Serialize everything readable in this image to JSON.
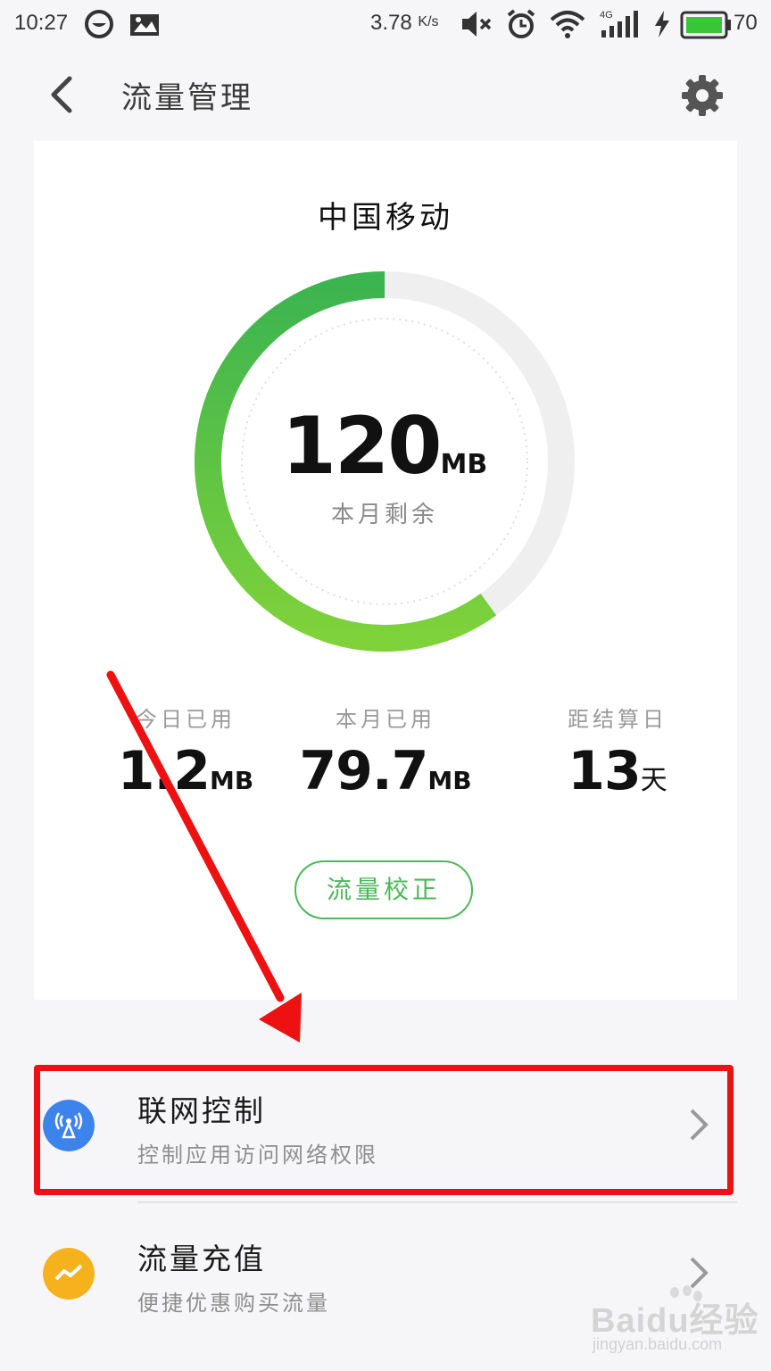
{
  "status_bar": {
    "time": "10:27",
    "speed_value": "3.78",
    "speed_unit": "K/s",
    "network_type": "4G",
    "battery_level": "70",
    "icons": [
      "chat-bubble-icon",
      "image-notification-icon",
      "mute-icon",
      "alarm-icon",
      "wifi-icon",
      "signal-icon",
      "charging-icon",
      "battery-icon"
    ]
  },
  "header": {
    "title": "流量管理",
    "back_icon": "back-arrow-icon",
    "settings_icon": "gear-icon"
  },
  "card": {
    "carrier": "中国移动",
    "remaining": {
      "value": "120",
      "unit": "MB",
      "label": "本月剩余",
      "ring_fill_fraction": 0.6
    },
    "stats": [
      {
        "label": "今日已用",
        "value": "1.2",
        "unit": "MB"
      },
      {
        "label": "本月已用",
        "value": "79.7",
        "unit": "MB"
      },
      {
        "label": "距结算日",
        "value": "13",
        "unit": "天"
      }
    ],
    "calibrate_button": "流量校正"
  },
  "list": [
    {
      "title": "联网控制",
      "subtitle": "控制应用访问网络权限",
      "icon": "antenna-icon",
      "icon_color": "#3d83ec"
    },
    {
      "title": "流量充值",
      "subtitle": "便捷优惠购买流量",
      "icon": "trend-icon",
      "icon_color": "#f6b21c"
    }
  ],
  "colors": {
    "accent_green": "#4cb85a",
    "ring_green_start": "#3cb450",
    "ring_green_end": "#7fd23a",
    "annotation_red": "#ee1111"
  },
  "watermark": {
    "text": "Baidu经验",
    "url": "jingyan.baidu.com"
  }
}
